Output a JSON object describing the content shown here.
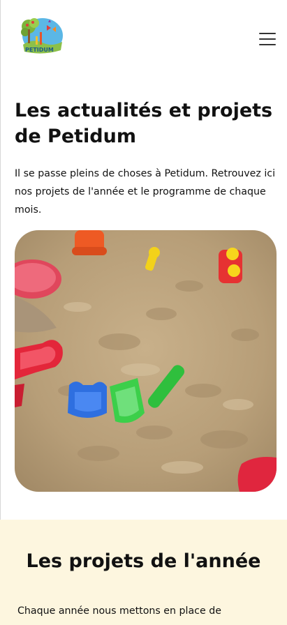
{
  "header": {
    "logo": {
      "text": "PETIDUM",
      "icon": "petidum-logo"
    },
    "menu_icon": "hamburger-menu-icon"
  },
  "main": {
    "title": "Les actualités et projets de Petidum",
    "intro": "Il se passe pleins de choses à Petidum. Retrouvez ici nos projets de l'année et le programme de chaque mois."
  },
  "hero_image": {
    "subject": "sandbox-toys-photo"
  },
  "projects": {
    "title": "Les projets de l'année",
    "text": "Chaque année nous mettons en place de"
  },
  "colors": {
    "projects_background": "#fdf6df",
    "text": "#111111",
    "menu_icon": "#333333"
  }
}
